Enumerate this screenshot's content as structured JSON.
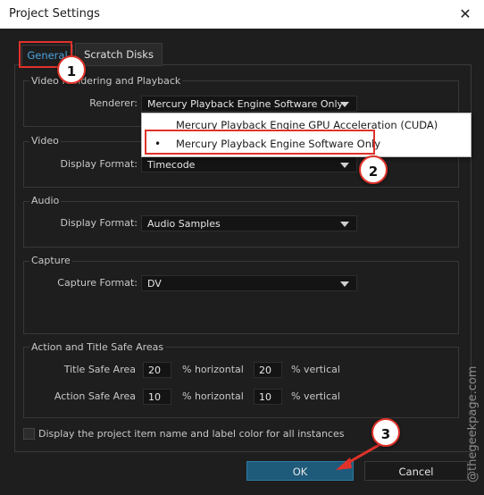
{
  "window": {
    "title": "Project Settings",
    "close_glyph": "✕"
  },
  "tabs": [
    {
      "label": "General"
    },
    {
      "label": "Scratch Disks"
    }
  ],
  "video_rendering": {
    "label": "Video Rendering and Playback",
    "renderer_label": "Renderer:",
    "renderer_value": "Mercury Playback Engine Software Only"
  },
  "renderer_dropdown": {
    "options": [
      {
        "label": "Mercury Playback Engine GPU Acceleration (CUDA)",
        "selected": false
      },
      {
        "label": "Mercury Playback Engine Software Only",
        "selected": true
      }
    ],
    "bullet": "•"
  },
  "video": {
    "label": "Video",
    "display_format_label": "Display Format:",
    "display_format_value": "Timecode"
  },
  "audio": {
    "label": "Audio",
    "display_format_label": "Display Format:",
    "display_format_value": "Audio Samples"
  },
  "capture": {
    "label": "Capture",
    "capture_format_label": "Capture Format:",
    "capture_format_value": "DV"
  },
  "safe_areas": {
    "label": "Action and Title Safe Areas",
    "title_label": "Title Safe Area",
    "title_horizontal": "20",
    "title_vertical": "20",
    "action_label": "Action Safe Area",
    "action_horizontal": "10",
    "action_vertical": "10",
    "horizontal_unit": "% horizontal",
    "vertical_unit": "% vertical"
  },
  "checkbox": {
    "label": "Display the project item name and label color for all instances",
    "checked": false
  },
  "buttons": {
    "ok": "OK",
    "cancel": "Cancel"
  },
  "callouts": [
    "1",
    "2",
    "3"
  ],
  "watermark": "@thegeekpage.com",
  "colors": {
    "accent_tab": "#4aa3df",
    "callout_border": "#e0322a",
    "ok_button": "#1e5a7a"
  }
}
